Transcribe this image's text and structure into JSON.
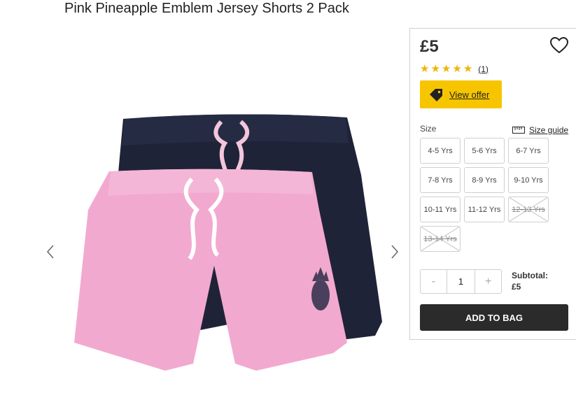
{
  "product": {
    "title": "Pink Pineapple Emblem Jersey Shorts 2 Pack",
    "price": "£5",
    "rating": {
      "stars": 5,
      "review_count": "(1)"
    },
    "offer_label": "View offer"
  },
  "size": {
    "label": "Size",
    "guide_label": "Size guide",
    "options": [
      {
        "label": "4-5 Yrs",
        "available": true
      },
      {
        "label": "5-6 Yrs",
        "available": true
      },
      {
        "label": "6-7 Yrs",
        "available": true
      },
      {
        "label": "7-8 Yrs",
        "available": true
      },
      {
        "label": "8-9 Yrs",
        "available": true
      },
      {
        "label": "9-10 Yrs",
        "available": true
      },
      {
        "label": "10-11 Yrs",
        "available": true
      },
      {
        "label": "11-12 Yrs",
        "available": true
      },
      {
        "label": "12-13 Yrs",
        "available": false
      },
      {
        "label": "13-14 Yrs",
        "available": false
      }
    ]
  },
  "quantity": {
    "minus": "-",
    "value": "1",
    "plus": "+"
  },
  "subtotal": {
    "label": "Subtotal:",
    "value": "£5"
  },
  "add_to_bag": "ADD TO BAG",
  "colors": {
    "offer": "#f7c500",
    "star": "#f0b400",
    "button": "#2b2b2b"
  }
}
